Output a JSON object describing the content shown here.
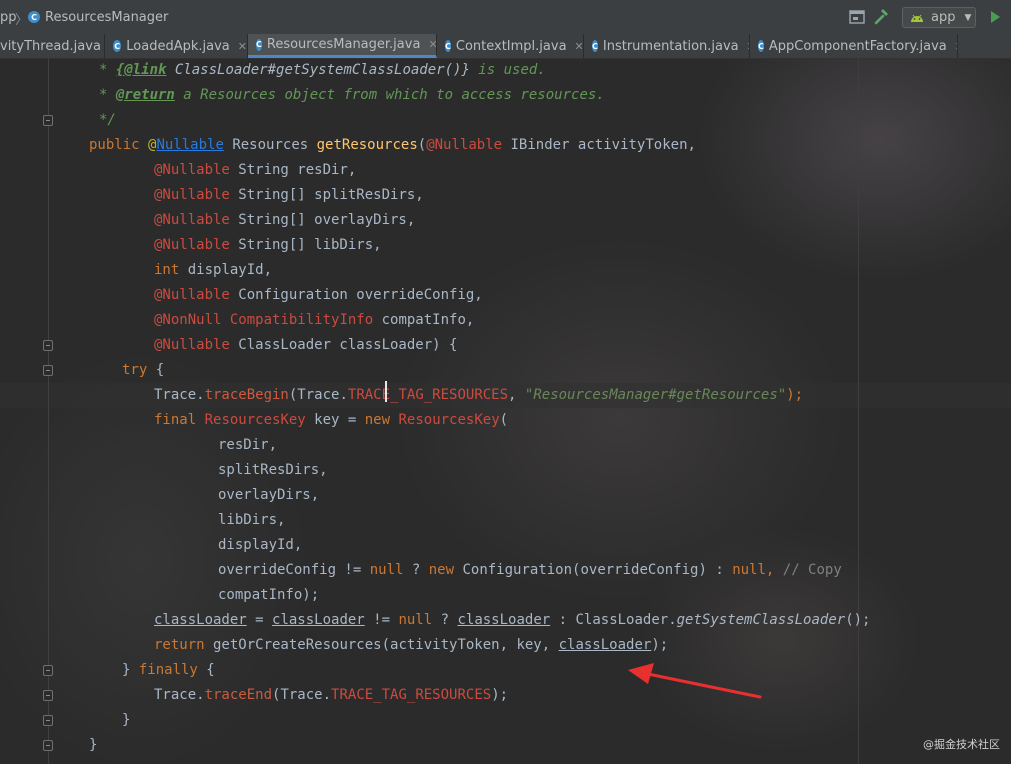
{
  "breadcrumb": {
    "app": "pp",
    "file": "ResourcesManager"
  },
  "toolbar": {
    "run_config": "app"
  },
  "colors": {
    "run_green": "#499c54",
    "build_green": "#59a869",
    "active_tab_underline": "#4a88c7",
    "arrow_red": "#e8312f"
  },
  "tabs": [
    {
      "label": "vityThread.java",
      "active": false,
      "icon": "java-class-icon"
    },
    {
      "label": "LoadedApk.java",
      "active": false,
      "icon": "java-class-icon"
    },
    {
      "label": "ResourcesManager.java",
      "active": true,
      "icon": "java-class-icon"
    },
    {
      "label": "ContextImpl.java",
      "active": false,
      "icon": "java-class-icon"
    },
    {
      "label": "Instrumentation.java",
      "active": false,
      "icon": "java-class-icon"
    },
    {
      "label": "AppComponentFactory.java",
      "active": false,
      "icon": "java-class-icon"
    }
  ],
  "code": {
    "l1_star": "* ",
    "l1_tag": "{@link",
    "l1_ref": " ClassLoader#getSystemClassLoader()}",
    "l1_rest": " is used.",
    "l2_star": "* ",
    "l2_tag": "@return",
    "l2_rest": " a Resources object from which to access resources.",
    "l3": "*/",
    "l4_public": "public ",
    "l4_at": "@",
    "l4_nullable": "Nullable",
    "l4_type": " Resources ",
    "l4_method": "getResources",
    "l4_paren": "(",
    "l4_ann": "@Nullable",
    "l4_rest": " IBinder activityToken,",
    "l5_ann": "@Nullable",
    "l5_rest": " String resDir,",
    "l6_ann": "@Nullable",
    "l6_rest": " String[] splitResDirs,",
    "l7_ann": "@Nullable",
    "l7_rest": " String[] overlayDirs,",
    "l8_ann": "@Nullable",
    "l8_rest": " String[] libDirs,",
    "l9_kw": "int",
    "l9_rest": " displayId,",
    "l10_ann": "@Nullable",
    "l10_rest": " Configuration overrideConfig,",
    "l11_ann": "@NonNull",
    "l11_cls": " CompatibilityInfo",
    "l11_rest": " compatInfo,",
    "l12_ann": "@Nullable",
    "l12_rest": " ClassLoader classLoader) {",
    "l13_kw": "try",
    "l13_rest": " {",
    "l14_a": "Trace.",
    "l14_m": "traceBegin",
    "l14_b": "(Trace.",
    "l14_c": "TRACE_TAG_RESOURCES",
    "l14_d": ", ",
    "l14_s": "\"ResourcesManager#getResources\"",
    "l14_e": ");",
    "l15_kw": "final",
    "l15_cls": " ResourcesKey",
    "l15_mid": " key = ",
    "l15_new": "new",
    "l15_cls2": " ResourcesKey",
    "l15_end": "(",
    "l16": "resDir,",
    "l17": "splitResDirs,",
    "l18": "overlayDirs,",
    "l19": "libDirs,",
    "l20": "displayId,",
    "l21_a": "overrideConfig != ",
    "l21_null1": "null",
    "l21_b": " ? ",
    "l21_new": "new",
    "l21_c": " Configuration(overrideConfig) : ",
    "l21_null2": "null",
    "l21_d": ", ",
    "l21_cmt": "// Copy",
    "l22": "compatInfo);",
    "l23_v1": "classLoader",
    "l23_a": " = ",
    "l23_v2": "classLoader",
    "l23_b": " != ",
    "l23_null": "null",
    "l23_c": " ? ",
    "l23_v3": "classLoader",
    "l23_d": " : ClassLoader.",
    "l23_m": "getSystemClassLoader",
    "l23_e": "();",
    "l24_kw": "return",
    "l24_a": " getOrCreateResources(activityToken, key, ",
    "l24_v": "classLoader",
    "l24_b": ");",
    "l25_a": "} ",
    "l25_kw": "finally",
    "l25_b": " {",
    "l26_a": "Trace.",
    "l26_m": "traceEnd",
    "l26_b": "(Trace.",
    "l26_c": "TRACE_TAG_RESOURCES",
    "l26_d": ");",
    "l27": "}",
    "l28": "}"
  },
  "watermark": "@掘金技术社区"
}
